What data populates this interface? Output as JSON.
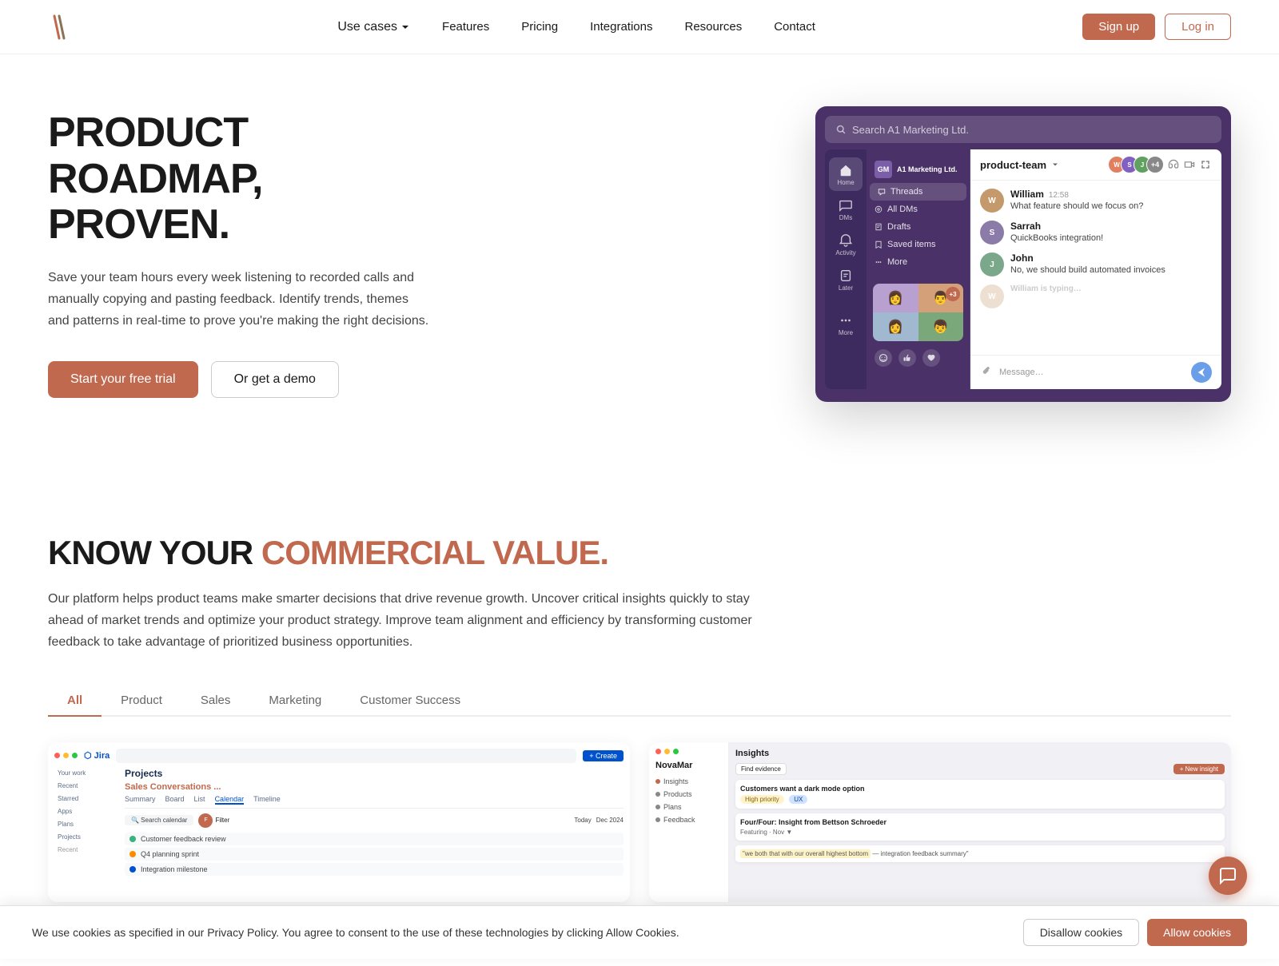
{
  "nav": {
    "logo_text": "//",
    "links": [
      {
        "label": "Use cases",
        "has_dropdown": true
      },
      {
        "label": "Features",
        "has_dropdown": false
      },
      {
        "label": "Pricing",
        "has_dropdown": false
      },
      {
        "label": "Integrations",
        "has_dropdown": false
      },
      {
        "label": "Resources",
        "has_dropdown": false
      },
      {
        "label": "Contact",
        "has_dropdown": false
      }
    ],
    "signup_label": "Sign up",
    "login_label": "Log in"
  },
  "hero": {
    "title": "PRODUCT ROADMAP, PROVEN.",
    "subtitle": "Save your team hours every week listening to recorded calls and manually copying and pasting feedback. Identify trends, themes and patterns in real-time to prove you're making the right decisions.",
    "cta_primary": "Start your free trial",
    "cta_secondary": "Or get a demo",
    "mockup": {
      "search_placeholder": "Search A1 Marketing Ltd.",
      "company_name": "A1 Marketing Ltd.",
      "channel_name": "product-team",
      "channels": [
        {
          "label": "Threads",
          "icon": "thread"
        },
        {
          "label": "All DMs",
          "icon": "dm"
        },
        {
          "label": "Drafts",
          "icon": "draft"
        },
        {
          "label": "Saved items",
          "icon": "bookmark"
        },
        {
          "label": "More",
          "icon": "more"
        }
      ],
      "messages": [
        {
          "name": "William",
          "time": "12:58",
          "text": "What feature should we focus on?",
          "avatar_color": "#c49a6c"
        },
        {
          "name": "Sarrah",
          "time": "",
          "text": "QuickBooks integration!",
          "avatar_color": "#8a7ba8"
        },
        {
          "name": "John",
          "time": "",
          "text": "No, we should build automated invoices",
          "avatar_color": "#7ba88a"
        }
      ],
      "icon_nav": [
        {
          "label": "Home",
          "icon": "home"
        },
        {
          "label": "DMs",
          "icon": "message"
        },
        {
          "label": "Activity",
          "icon": "bell"
        },
        {
          "label": "Later",
          "icon": "clock"
        },
        {
          "label": "More",
          "icon": "dots"
        }
      ],
      "avatar_count": "+4"
    }
  },
  "section2": {
    "title_plain": "KNOW YOUR",
    "title_highlight": "COMMERCIAL VALUE.",
    "subtitle": "Our platform helps product teams make smarter decisions that drive revenue growth. Uncover critical insights quickly to stay ahead of market trends and optimize your product strategy. Improve team alignment and efficiency by transforming customer feedback to take advantage of prioritized business opportunities.",
    "tabs": [
      {
        "label": "All",
        "active": true
      },
      {
        "label": "Product",
        "active": false
      },
      {
        "label": "Sales",
        "active": false
      },
      {
        "label": "Marketing",
        "active": false
      },
      {
        "label": "Customer Success",
        "active": false
      }
    ],
    "screenshots": [
      {
        "type": "jira",
        "title": "Sales Conversations"
      },
      {
        "type": "novamar",
        "title": "Insights"
      }
    ]
  },
  "cookie": {
    "message": "We use cookies as specified in our Privacy Policy. You agree to consent to the use of these technologies by clicking Allow Cookies.",
    "disallow_label": "Disallow cookies",
    "allow_label": "Allow cookies"
  }
}
